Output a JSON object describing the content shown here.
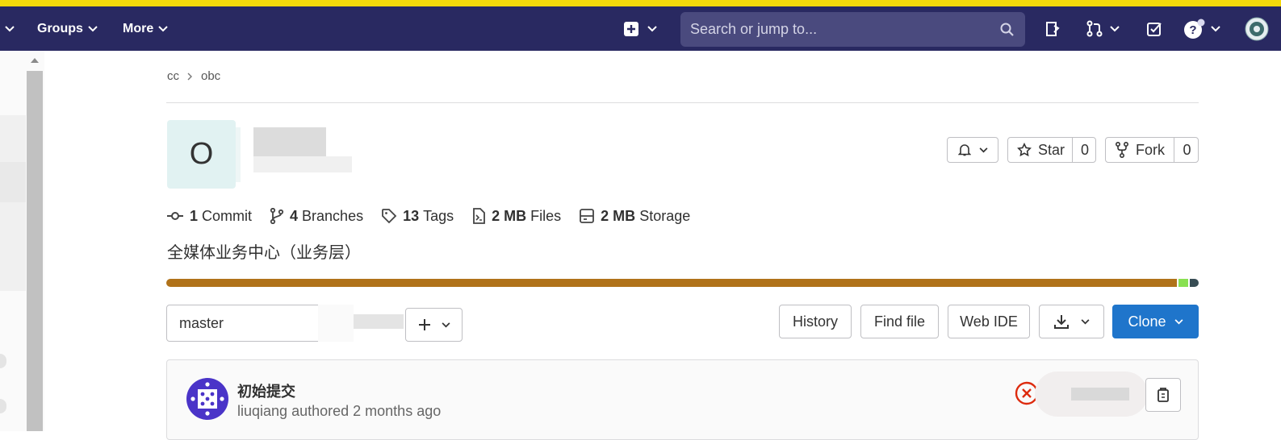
{
  "colors": {
    "top_strip": "#f5d90a",
    "navbar_bg": "#292961",
    "primary_button": "#1f75cb",
    "language_bar": [
      "#b07219",
      "#89e051",
      "#384d54"
    ]
  },
  "navbar": {
    "groups_label": "Groups",
    "more_label": "More",
    "search_placeholder": "Search or jump to...",
    "icons": [
      "plus-square-icon",
      "search-icon",
      "todo-icon",
      "merge-request-icon",
      "issues-icon",
      "help-icon",
      "user-avatar"
    ]
  },
  "breadcrumb": {
    "group": "cc",
    "project": "obc"
  },
  "project": {
    "avatar_letter": "O",
    "description": "全媒体业务中心（业务层）"
  },
  "actions": {
    "star_label": "Star",
    "star_count": "0",
    "fork_label": "Fork",
    "fork_count": "0"
  },
  "stats": {
    "commits_num": "1",
    "commits_label": "Commit",
    "branches_num": "4",
    "branches_label": "Branches",
    "tags_num": "13",
    "tags_label": "Tags",
    "files_num": "2 MB",
    "files_label": "Files",
    "storage_num": "2 MB",
    "storage_label": "Storage"
  },
  "toolbar": {
    "branch": "master",
    "history_label": "History",
    "find_file_label": "Find file",
    "web_ide_label": "Web IDE",
    "clone_label": "Clone"
  },
  "last_commit": {
    "title": "初始提交",
    "author": "liuqiang",
    "verb": "authored",
    "time": "2 months ago"
  }
}
